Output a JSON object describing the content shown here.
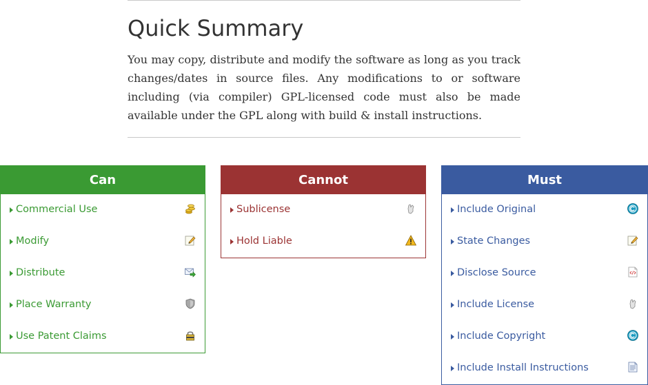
{
  "summary": {
    "title": "Quick Summary",
    "text": "You may copy, distribute and modify the software as long as you track changes/dates in source files. Any modifications to or software including (via compiler) GPL-licensed code must also be made available under the GPL along with build & install instructions."
  },
  "can": {
    "heading": "Can",
    "color": "#3a9a33",
    "items": [
      {
        "label": "Commercial Use",
        "icon": "coins-icon"
      },
      {
        "label": "Modify",
        "icon": "pencil-icon"
      },
      {
        "label": "Distribute",
        "icon": "envelope-arrow-icon"
      },
      {
        "label": "Place Warranty",
        "icon": "shield-icon"
      },
      {
        "label": "Use Patent Claims",
        "icon": "lock-icon"
      }
    ]
  },
  "cannot": {
    "heading": "Cannot",
    "color": "#9b3333",
    "items": [
      {
        "label": "Sublicense",
        "icon": "hand-icon"
      },
      {
        "label": "Hold Liable",
        "icon": "warning-icon"
      }
    ]
  },
  "must": {
    "heading": "Must",
    "color": "#3a5ba0",
    "items": [
      {
        "label": "Include Original",
        "icon": "copyright-icon"
      },
      {
        "label": "State Changes",
        "icon": "pencil-icon"
      },
      {
        "label": "Disclose Source",
        "icon": "code-file-icon"
      },
      {
        "label": "Include License",
        "icon": "hand-icon"
      },
      {
        "label": "Include Copyright",
        "icon": "copyright-icon"
      },
      {
        "label": "Include Install Instructions",
        "icon": "document-icon"
      }
    ]
  }
}
